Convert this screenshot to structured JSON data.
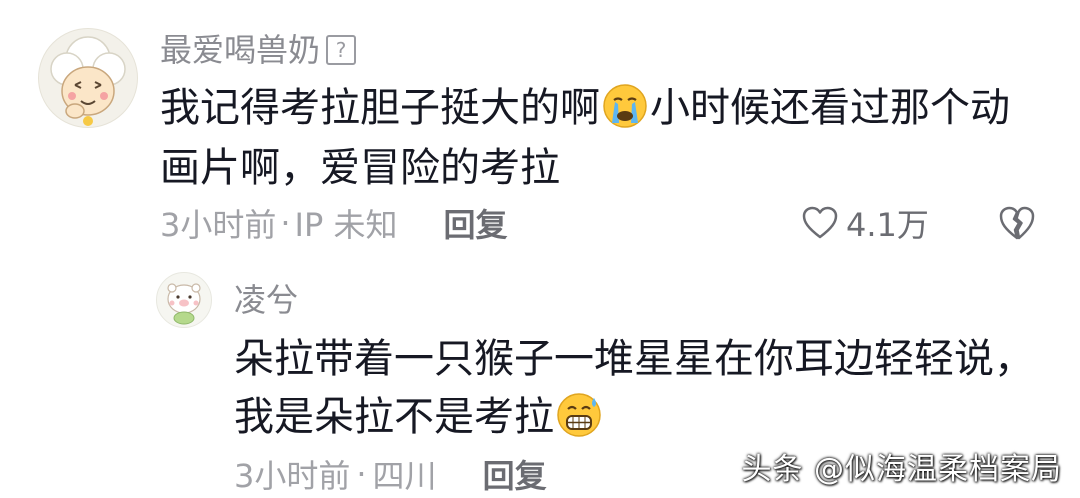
{
  "comment": {
    "username": "最爱喝兽奶",
    "help_icon_glyph": "?",
    "text_part1": "我记得考拉胆子挺大的啊",
    "emoji1": "crying-face-emoji",
    "text_part2": "小时候还看过那个动画片啊，爱冒险的考拉",
    "time": "3小时前",
    "separator": "·",
    "location": "IP 未知",
    "reply_label": "回复",
    "like_count": "4.1万"
  },
  "reply": {
    "username": "凌兮",
    "text_part1": "朵拉带着一只猴子一堆星星在你耳边轻轻说，我是朵拉不是考拉",
    "emoji1": "grinning-sweat-emoji",
    "time": "3小时前",
    "separator": "·",
    "location": "四川",
    "reply_label": "回复"
  },
  "watermark": "头条 @似海温柔档案局",
  "colors": {
    "text": "#161823",
    "secondary": "#8a8b91",
    "meta": "#a1a2a7",
    "action": "#6b6c72",
    "emoji_yellow": "#ffc93c"
  }
}
